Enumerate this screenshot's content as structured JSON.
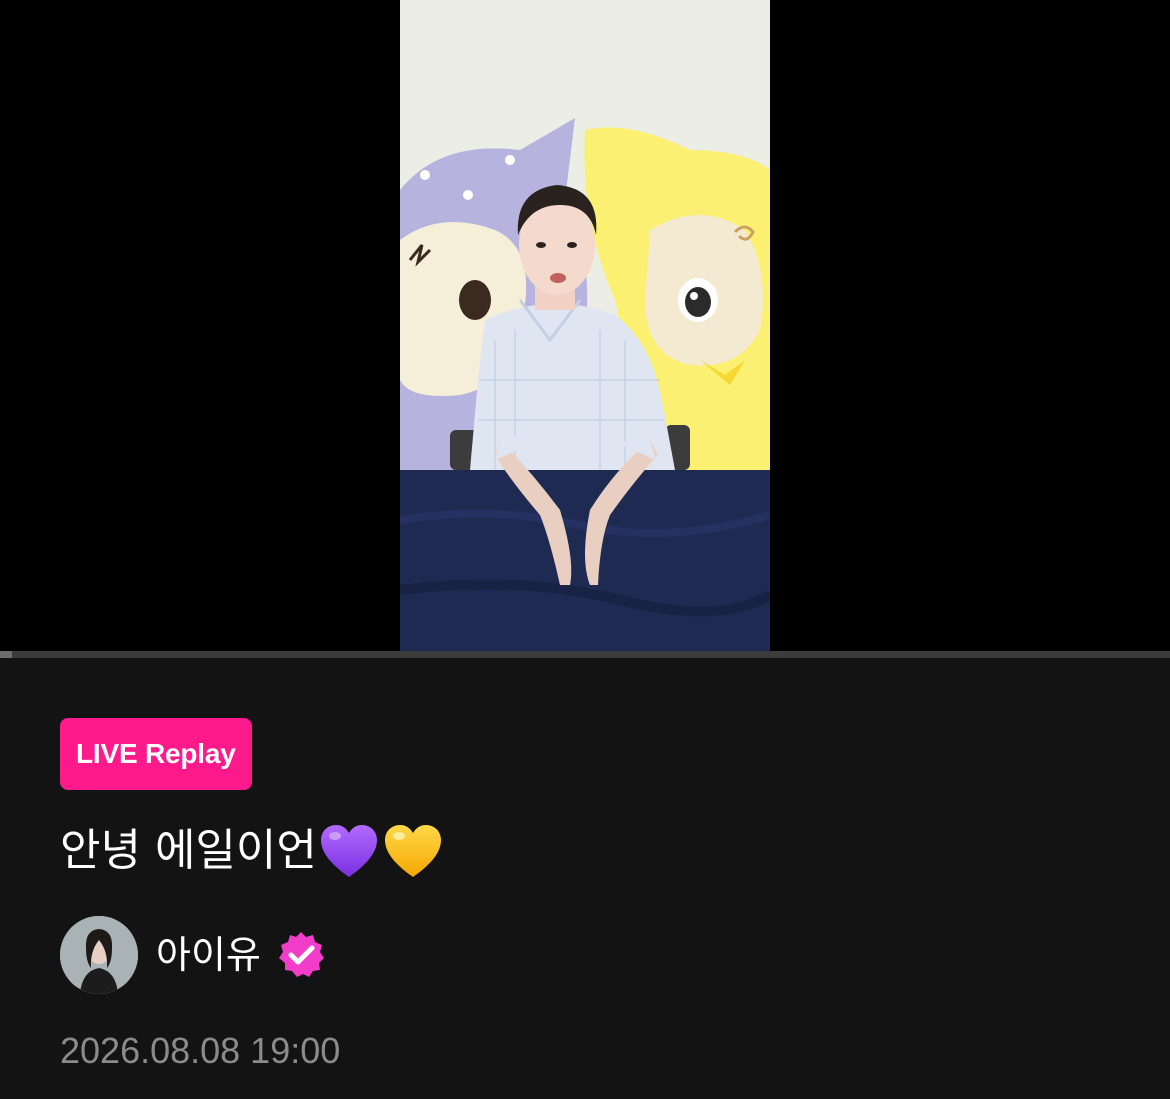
{
  "player": {
    "progress_fraction": 0.01
  },
  "badge": {
    "label": "LIVE Replay",
    "color": "#ff1a8c"
  },
  "post": {
    "title_text": "안녕 에일이언",
    "title_emojis": [
      "purple-heart",
      "yellow-heart"
    ]
  },
  "artist": {
    "name": "아이유",
    "verified": true,
    "verified_color": "#f23dcb"
  },
  "timestamp": "2026.08.08 19:00"
}
